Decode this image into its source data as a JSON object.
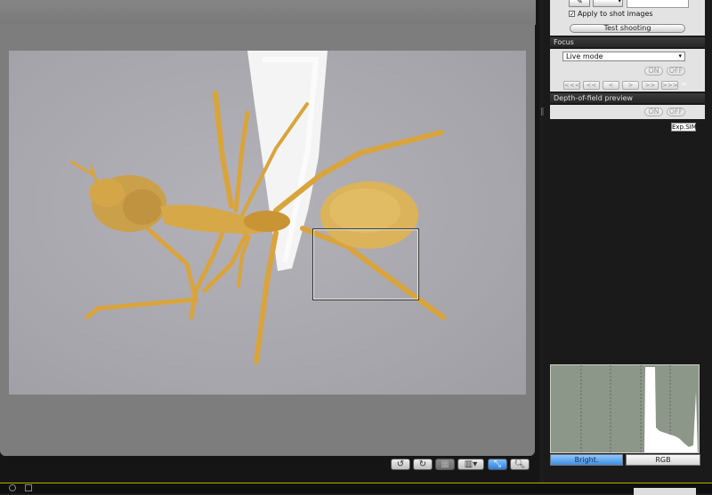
{
  "right_panel": {
    "apply_to_shot_label": "Apply to shot images",
    "apply_to_shot_checked": true,
    "test_shooting_label": "Test shooting",
    "focus": {
      "header": "Focus",
      "mode_value": "Live mode",
      "on_label": "ON",
      "off_label": "OFF",
      "nav_buttons": [
        "<<<",
        "<<",
        "<",
        ">",
        ">>",
        ">>>"
      ],
      "infinity_symbol": "∞"
    },
    "dof": {
      "header": "Depth-of-field preview",
      "on_label": "ON",
      "off_label": "OFF"
    },
    "exp_sim_label": "Exp.SIM"
  },
  "histogram": {
    "tabs": [
      "Bright.",
      "RGB"
    ],
    "active_tab": "Bright."
  },
  "viewer_toolbar": {
    "rotate_left_icon": "rotate-left-icon",
    "rotate_right_icon": "rotate-right-icon",
    "grid_icon": "grid-icon",
    "aspect_icon": "aspect-ratio-icon",
    "zoom_frame_icon": "zoom-frame-icon",
    "magnify_icon": "magnify-icon"
  },
  "colors": {
    "accent": "#3f8ee0",
    "panel_bg": "#e3e3e3",
    "header_bg": "#2b2b2b",
    "status_line": "#b9b000"
  }
}
